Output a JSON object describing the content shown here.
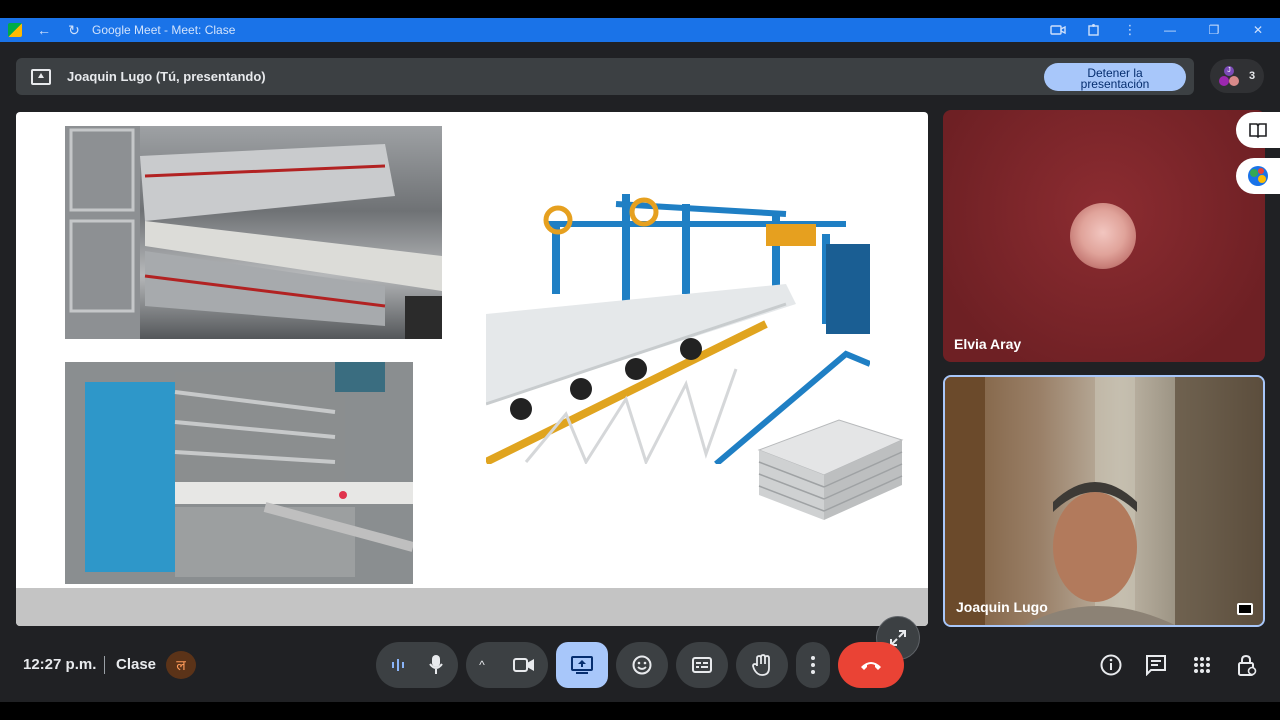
{
  "browser": {
    "title": "Google Meet - Meet: Clase"
  },
  "banner": {
    "presenter_text": "Joaquin Lugo (Tú, presentando)",
    "stop_label_line1": "Detener la",
    "stop_label_line2": "presentación"
  },
  "people": {
    "count": "3",
    "avatar_letter": "J"
  },
  "participants": [
    {
      "name": "Elvia Aray"
    },
    {
      "name": "Joaquin Lugo"
    }
  ],
  "footer": {
    "time": "12:27 p.m.",
    "meeting_name": "Clase"
  },
  "colors": {
    "browser_bar": "#1a73e8",
    "app_bg": "#202124",
    "stop_button": "#a8c7fa",
    "present_active": "#a8c7fa",
    "end_call": "#ea4335",
    "tile_elvia_bg": "#7a2428"
  },
  "icons": [
    "present-icon",
    "people-avatars",
    "book-icon",
    "globe-icon",
    "expand-icon",
    "pip-icon",
    "audio-level-icon",
    "mic-icon",
    "chevron-up-icon",
    "camera-icon",
    "present-screen-icon",
    "emoji-icon",
    "captions-icon",
    "raise-hand-icon",
    "more-vert-icon",
    "end-call-icon",
    "info-icon",
    "chat-icon",
    "apps-icon",
    "host-controls-icon"
  ]
}
